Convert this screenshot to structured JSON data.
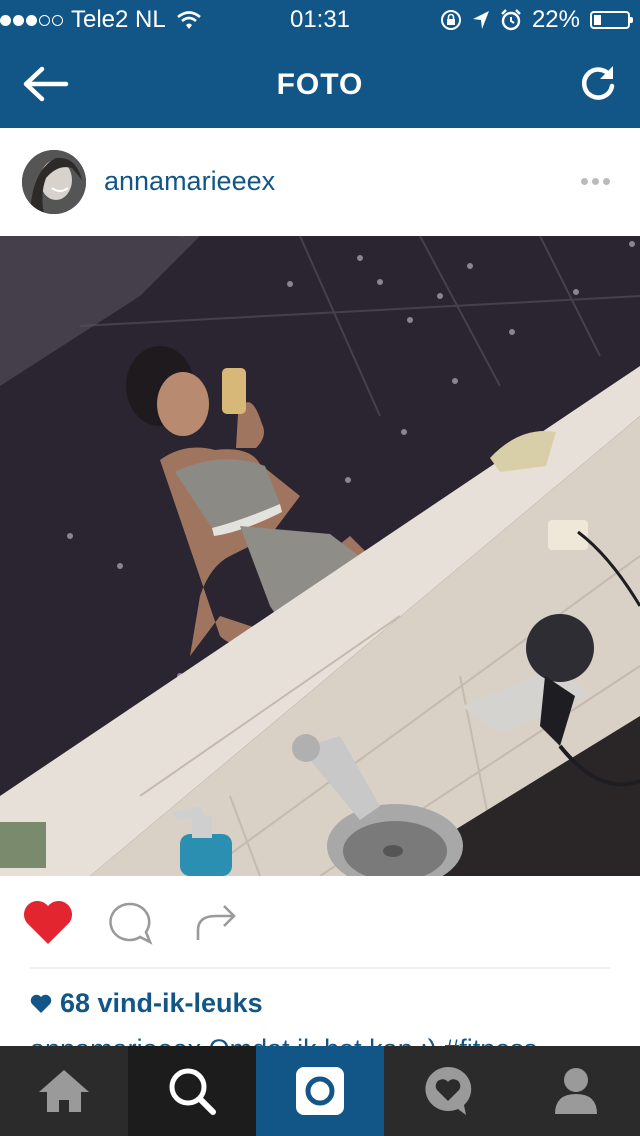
{
  "status_bar": {
    "carrier": "Tele2 NL",
    "time": "01:31",
    "battery": "22%",
    "battery_level": 0.22
  },
  "nav": {
    "title": "FOTO",
    "back_icon": "arrow-left-icon",
    "reload_icon": "refresh-icon"
  },
  "post": {
    "username": "annamarieeex",
    "likes": "68 vind-ik-leuks",
    "caption": "annamarieeex Omdat ik het kan :) #fitness"
  },
  "tabs": [
    {
      "name": "home",
      "icon": "home-icon"
    },
    {
      "name": "explore",
      "icon": "search-icon"
    },
    {
      "name": "camera",
      "icon": "camera-icon"
    },
    {
      "name": "activity",
      "icon": "heart-bubble-icon"
    },
    {
      "name": "profile",
      "icon": "profile-icon"
    }
  ],
  "colors": {
    "brand": "#125688",
    "like": "#e2252e",
    "tabbar": "#2b2b2b"
  }
}
